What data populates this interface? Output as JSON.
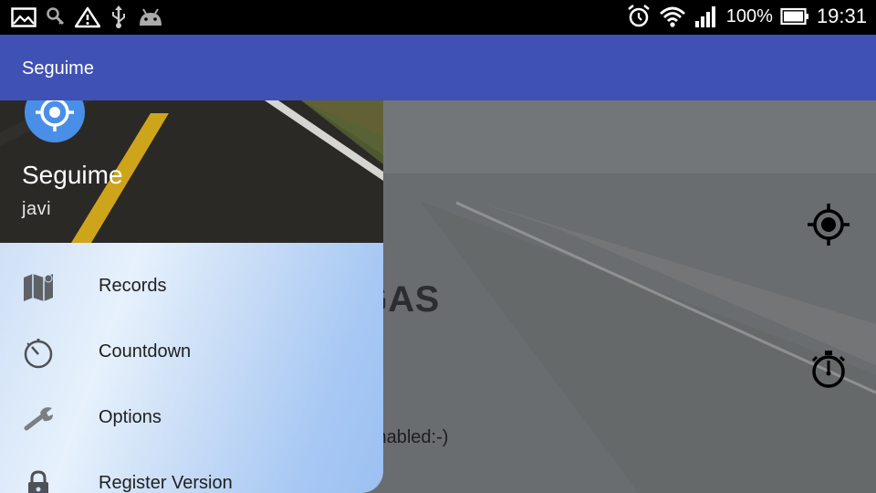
{
  "status_bar": {
    "left_icons": [
      "gallery-icon",
      "search-key-icon",
      "warning-icon",
      "usb-icon",
      "android-icon"
    ],
    "right_icons": [
      "alarm-icon",
      "wifi-icon",
      "signal-icon",
      "battery-icon"
    ],
    "battery_percent": "100%",
    "time": "19:31"
  },
  "app_bar": {
    "title": "Seguime"
  },
  "drawer": {
    "header": {
      "app_name": "Seguime",
      "user": "javi",
      "avatar_icon": "gps-target-icon"
    },
    "items": [
      {
        "label": "Records",
        "icon": "map-icon"
      },
      {
        "label": "Countdown",
        "icon": "timer-icon"
      },
      {
        "label": "Options",
        "icon": "wrench-icon"
      },
      {
        "label": "Register Version",
        "icon": "lock-icon"
      }
    ]
  },
  "main": {
    "hero_text": "E SIGAS",
    "notice_text": "ication is enabled:-)",
    "buttons": [
      {
        "icon": "locate-icon"
      },
      {
        "icon": "stopwatch-icon"
      }
    ]
  },
  "colors": {
    "app_bar": "#3F51B5",
    "avatar": "#4a8fe7"
  }
}
